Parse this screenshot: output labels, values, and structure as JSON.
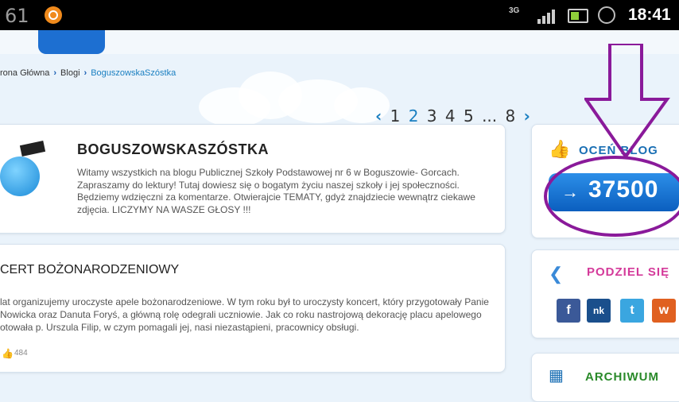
{
  "status_bar": {
    "left_number": "61",
    "network": "3G",
    "time": "18:41"
  },
  "breadcrumb": {
    "home": "rona Główna",
    "blogs": "Blogi",
    "current": "BoguszowskaSzóstka"
  },
  "pagination": {
    "prev": "‹",
    "pages": [
      "1",
      "2",
      "3",
      "4",
      "5",
      "...",
      "8"
    ],
    "next": "›",
    "active_page": "2"
  },
  "blog": {
    "title": "BOGUSZOWSKASZÓSTKA",
    "description": "Witamy wszystkich na blogu Publicznej Szkoły Podstawowej nr 6 w Boguszowie- Gorcach. Zapraszamy do lektury! Tutaj dowiesz się o bogatym życiu naszej szkoły i jej społeczności. Będziemy wdzięczni za komentarze. Otwierajcie TEMATY, gdyż znajdziecie wewnątrz ciekawe zdjęcia. LICZYMY NA WASZE GŁOSY !!!"
  },
  "post": {
    "title": "CERT BOŻONARODZENIOWY",
    "text": "lat organizujemy uroczyste apele bożonarodzeniowe. W tym roku był to uroczysty koncert, który przygotowały Panie Nowicka oraz Danuta Foryś, a główną rolę odegrali uczniowie. Jak co roku nastrojową dekorację placu apelowego otowała p. Urszula Filip, w czym pomagali jej, nasi niezastąpieni, pracownicy obsługi.",
    "likes": "484"
  },
  "sidebar": {
    "rate": {
      "title": "OCEŃ BLOG",
      "count": "37500",
      "arrow": "→"
    },
    "share": {
      "title": "PODZIEL SIĘ",
      "buttons": [
        "f",
        "nk",
        "t",
        "w"
      ]
    },
    "archive": {
      "title": "ARCHIWUM"
    }
  },
  "colors": {
    "accent_blue": "#1a7fc1",
    "annotation": "#8a1a9a"
  }
}
